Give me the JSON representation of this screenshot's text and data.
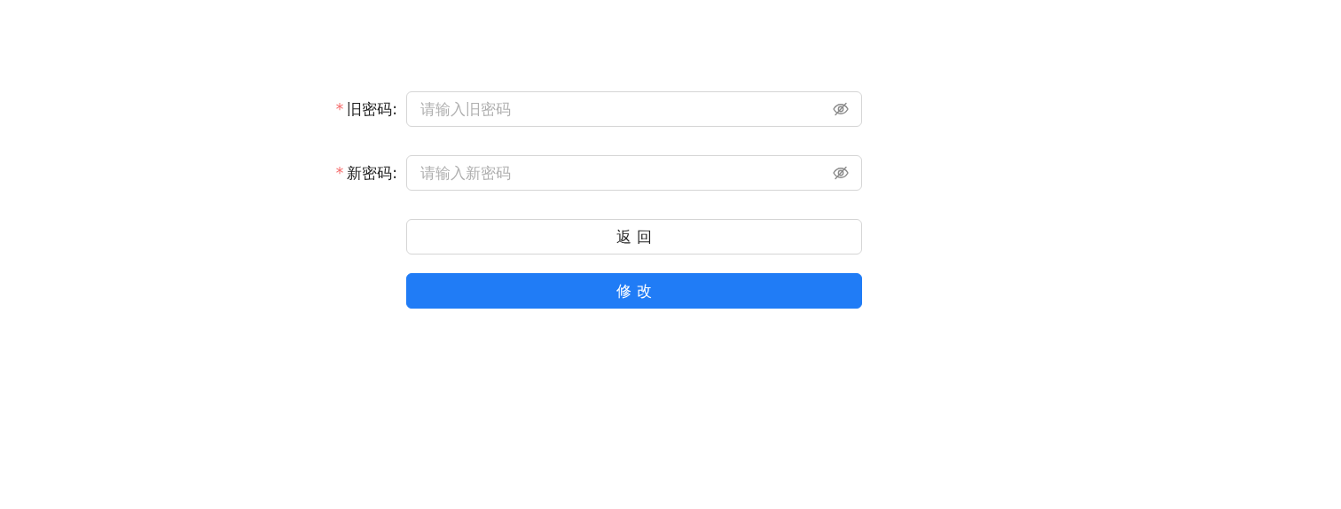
{
  "form": {
    "fields": [
      {
        "required_mark": "*",
        "label": "旧密码:",
        "placeholder": "请输入旧密码"
      },
      {
        "required_mark": "*",
        "label": "新密码:",
        "placeholder": "请输入新密码"
      }
    ],
    "buttons": [
      {
        "label": "返 回",
        "kind": "default"
      },
      {
        "label": "修 改",
        "kind": "primary"
      }
    ]
  }
}
